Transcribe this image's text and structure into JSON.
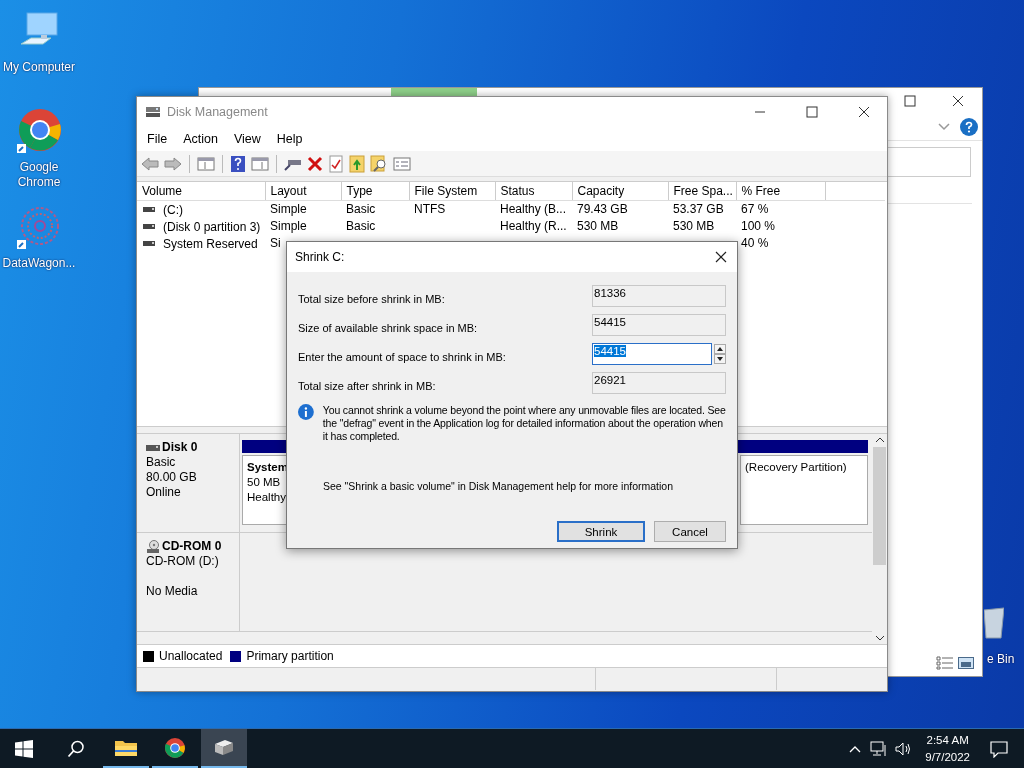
{
  "desktop_icons": [
    {
      "label": "My Computer",
      "kind": "computer"
    },
    {
      "label": "Google Chrome",
      "kind": "chrome"
    },
    {
      "label": "DataWagon...",
      "kind": "lace"
    }
  ],
  "recycle_bin": {
    "label": "e Bin"
  },
  "window": {
    "title": "Disk Management",
    "menu": [
      "File",
      "Action",
      "View",
      "Help"
    ],
    "table": {
      "columns": [
        "Volume",
        "Layout",
        "Type",
        "File System",
        "Status",
        "Capacity",
        "Free Spa...",
        "% Free"
      ],
      "rows": [
        {
          "volume": "(C:)",
          "layout": "Simple",
          "type": "Basic",
          "file_system": "NTFS",
          "status": "Healthy (B...",
          "capacity": "79.43 GB",
          "free_space": "53.37 GB",
          "free_pct": "67 %"
        },
        {
          "volume": "(Disk 0 partition 3)",
          "layout": "Simple",
          "type": "Basic",
          "status": "Healthy (R...",
          "capacity": "530 MB",
          "free_space": "530 MB",
          "free_pct": "100 %"
        },
        {
          "volume": "System Reserved",
          "layout": "Si",
          "free_pct": "40 %"
        }
      ]
    },
    "disks": [
      {
        "name": "Disk 0",
        "kind": "disk",
        "type": "Basic",
        "size": "80.00 GB",
        "status": "Online",
        "partitions": [
          {
            "lines": [
              "System",
              "50 MB",
              "Healthy"
            ]
          },
          {
            "lines": [
              "(Recovery Partition)"
            ]
          }
        ]
      },
      {
        "name": "CD-ROM 0",
        "kind": "cdrom",
        "type": "CD-ROM (D:)",
        "status": "No Media"
      }
    ],
    "legend": [
      {
        "label": "Unallocated",
        "color": "#000000"
      },
      {
        "label": "Primary partition",
        "color": "#000080"
      }
    ]
  },
  "dialog": {
    "title": "Shrink C:",
    "fields": [
      {
        "label": "Total size before shrink in MB:",
        "value": "81336",
        "kind": "readonly"
      },
      {
        "label": "Size of available shrink space in MB:",
        "value": "54415",
        "kind": "readonly"
      },
      {
        "label": "Enter the amount of space to shrink in MB:",
        "value": "54415",
        "kind": "spin",
        "selected": true
      },
      {
        "label": "Total size after shrink in MB:",
        "value": "26921",
        "kind": "readonly"
      }
    ],
    "info": "You cannot shrink a volume beyond the point where any unmovable files are located. See the \"defrag\" event in the Application log for detailed information about the operation when it has completed.",
    "help": "See \"Shrink a basic volume\" in Disk Management help for more information",
    "buttons": [
      {
        "label": "Shrink",
        "default": true
      },
      {
        "label": "Cancel",
        "default": false
      }
    ]
  },
  "taskbar": {
    "apps": [
      {
        "kind": "explorer",
        "selected": false
      },
      {
        "kind": "chrome",
        "selected": false
      },
      {
        "kind": "disk",
        "selected": true
      }
    ],
    "time": "2:54 AM",
    "date": "9/7/2022"
  }
}
